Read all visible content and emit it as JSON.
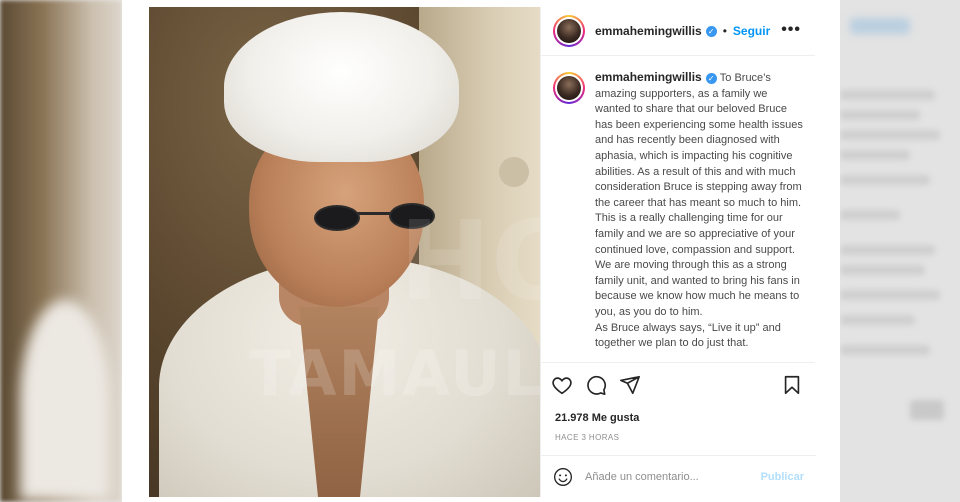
{
  "post": {
    "username": "emmahemingwillis",
    "follow_label": "Seguir",
    "separator": "•",
    "more_label": "•••",
    "watermark_top": "HO",
    "watermark_bottom": "TAMAULI",
    "caption_username": "emmahemingwillis",
    "caption_paragraphs": [
      "To Bruce’s amazing supporters, as a family we wanted to share that our beloved Bruce has been experiencing some health issues and has recently been diagnosed with aphasia, which is impacting his cognitive abilities. As a result of this and with much consideration Bruce is stepping away from the career that has meant so much to him.",
      "This is a really challenging time for our family and we are so appreciative of your continued love, compassion and support. We are moving through this as a strong family unit, and wanted to bring his fans in because we know how much he means to you, as you do to him.",
      "As Bruce always says, “Live it up” and together we plan to do just that."
    ],
    "likes": "21.978 Me gusta",
    "timestamp": "HACE 3 HORAS",
    "comment_placeholder": "Añade un comentario...",
    "publish_label": "Publicar"
  },
  "icons": [
    "heart-icon",
    "comment-icon",
    "share-icon",
    "bookmark-icon",
    "emoji-icon",
    "verified-icon",
    "more-icon"
  ],
  "colors": {
    "link": "#0095f6",
    "verified": "#3897f0",
    "publish_disabled": "#b2dffc",
    "text": "#262626",
    "muted": "#8e8e8e"
  }
}
